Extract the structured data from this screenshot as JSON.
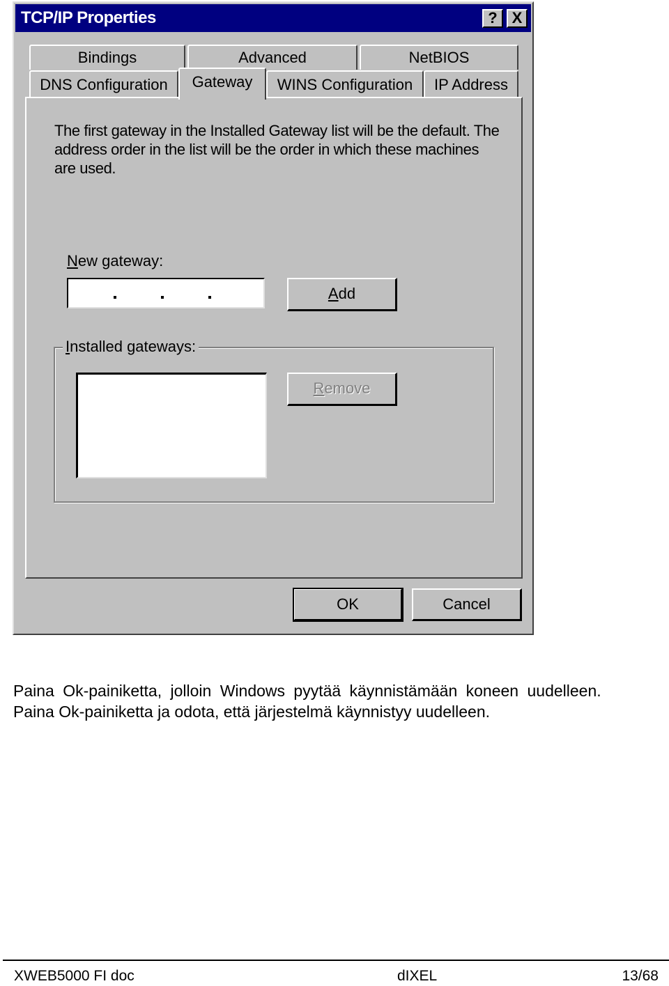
{
  "dialog": {
    "title": "TCP/IP Properties",
    "help_button": "?",
    "close_button": "X",
    "tabs_row1": [
      "Bindings",
      "Advanced",
      "NetBIOS"
    ],
    "tabs_row2": [
      "DNS Configuration",
      "Gateway",
      "WINS Configuration",
      "IP Address"
    ],
    "active_tab": "Gateway",
    "description": "The first gateway in the Installed Gateway list will be the default. The address order in the list will be the order in which these machines are used.",
    "new_gateway_label": "New gateway:",
    "new_gateway_value": ". . .",
    "add_button": "Add",
    "installed_gateways_label": "Installed gateways:",
    "installed_gateways": [],
    "remove_button": "Remove",
    "ok_button": "OK",
    "cancel_button": "Cancel"
  },
  "document": {
    "paragraph1": "Paina Ok-painiketta, jolloin Windows pyytää käynnistämään koneen uudelleen.",
    "paragraph2": "Paina Ok-painiketta ja odota, että järjestelmä käynnistyy uudelleen."
  },
  "footer": {
    "left": "XWEB5000 FI doc",
    "center": "dIXEL",
    "right": "13/68"
  }
}
